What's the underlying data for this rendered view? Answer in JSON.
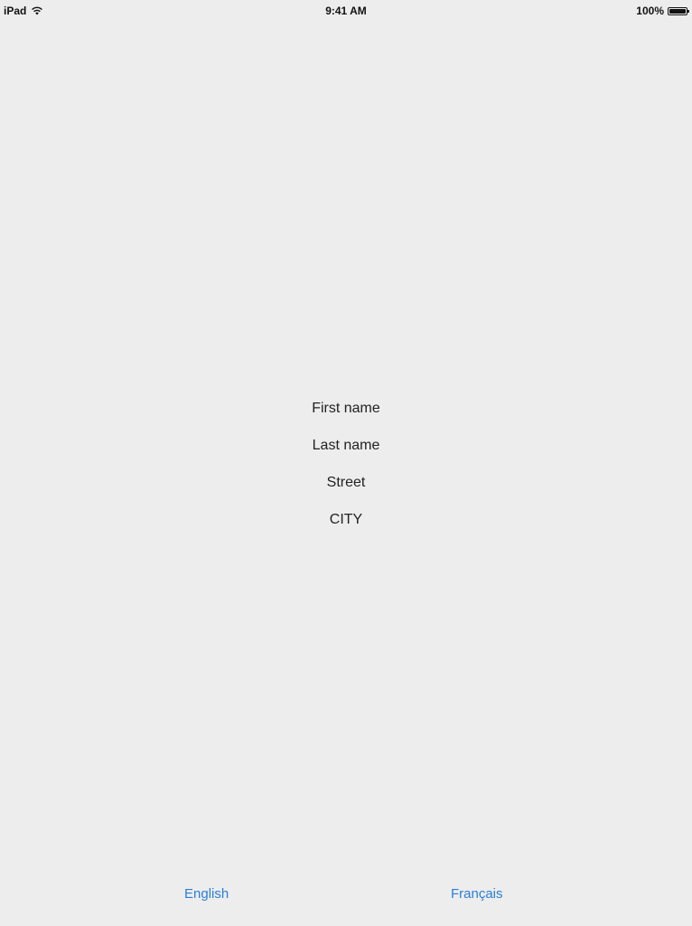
{
  "status_bar": {
    "device": "iPad",
    "time": "9:41 AM",
    "battery": "100%",
    "icons": [
      "wifi-icon",
      "battery-icon"
    ]
  },
  "form": {
    "first_name": "First name",
    "last_name": "Last name",
    "street": "Street",
    "city": "CITY"
  },
  "languages": {
    "english": "English",
    "french": "Français"
  },
  "colors": {
    "background": "#ededed",
    "link": "#2a7fd6",
    "text": "#222222"
  }
}
